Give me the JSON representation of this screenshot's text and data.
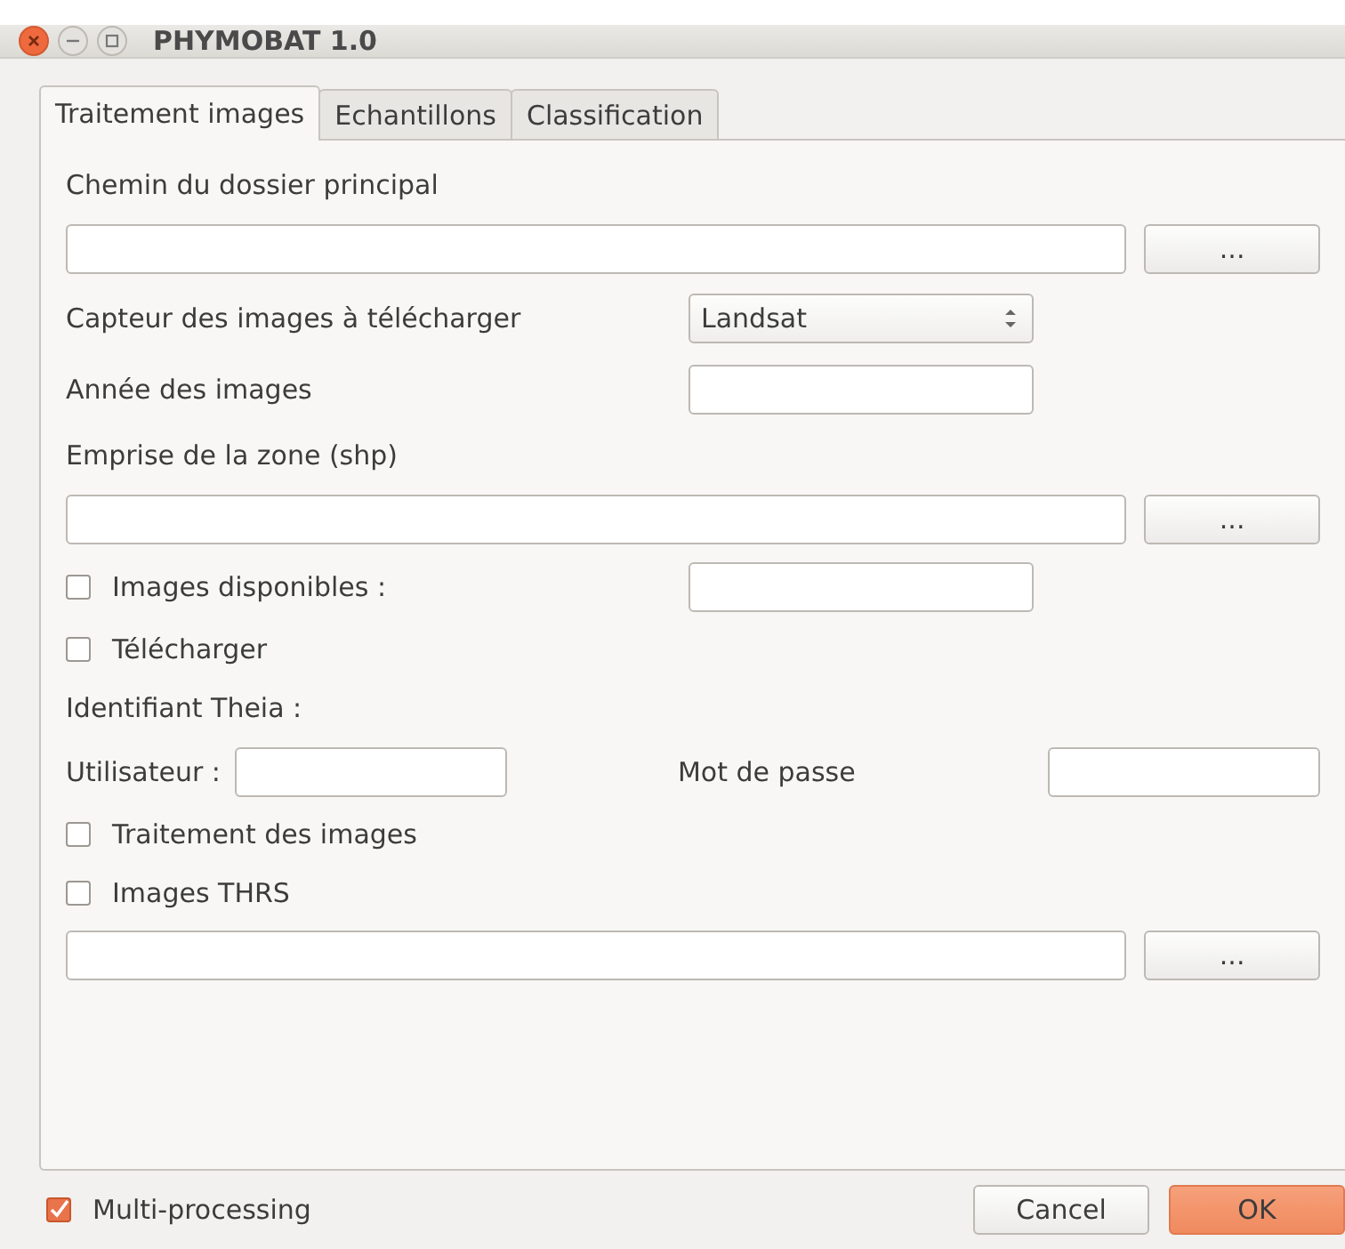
{
  "window": {
    "title": "PHYMOBAT 1.0"
  },
  "tabs": [
    {
      "label": "Traitement images",
      "selected": true
    },
    {
      "label": "Echantillons",
      "selected": false
    },
    {
      "label": "Classification",
      "selected": false
    }
  ],
  "rows": [
    {
      "kind": "heading",
      "label": "Chemin du dossier principal"
    },
    {
      "kind": "path",
      "value": "",
      "button": "..."
    },
    {
      "kind": "combo",
      "label": "Capteur des images à télécharger",
      "value": "Landsat"
    },
    {
      "kind": "text",
      "label": "Année des images",
      "value": ""
    },
    {
      "kind": "heading",
      "label": "Emprise de la zone (shp)"
    },
    {
      "kind": "path",
      "value": "",
      "button": "..."
    },
    {
      "kind": "checktext",
      "label": "Images disponibles :",
      "checked": false,
      "value": ""
    },
    {
      "kind": "check",
      "label": "Télécharger",
      "checked": false
    },
    {
      "kind": "heading",
      "label": "Identifiant Theia :"
    },
    {
      "kind": "credentials",
      "user_label": "Utilisateur :",
      "user_value": "",
      "password_label": "Mot de passe",
      "password_value": ""
    },
    {
      "kind": "check",
      "label": "Traitement des images",
      "checked": false
    },
    {
      "kind": "check",
      "label": "Images THRS",
      "checked": false
    },
    {
      "kind": "path",
      "value": "",
      "button": "..."
    }
  ],
  "multiprocessing": {
    "label": "Multi-processing",
    "checked": true
  },
  "buttons": [
    {
      "label": "Cancel",
      "kind": "normal"
    },
    {
      "label": "OK",
      "kind": "default"
    }
  ]
}
